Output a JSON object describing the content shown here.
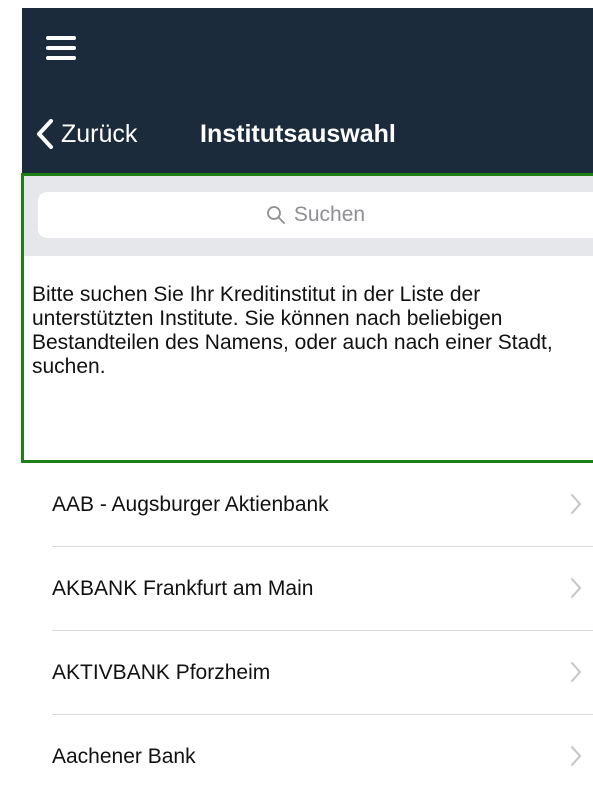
{
  "nav": {
    "back_label": "Zurück",
    "title": "Institutsauswahl"
  },
  "search": {
    "placeholder": "Suchen",
    "help_text": "Bitte suchen Sie Ihr Kreditinstitut in der Liste der unterstützten Institute. Sie können nach beliebigen Bestandteilen des Namens, oder auch nach einer Stadt, suchen."
  },
  "banks": [
    {
      "name": "AAB - Augsburger Aktienbank"
    },
    {
      "name": "AKBANK Frankfurt am Main"
    },
    {
      "name": "AKTIVBANK Pforzheim"
    },
    {
      "name": "Aachener Bank"
    }
  ],
  "colors": {
    "header_bg": "#1b2b3c",
    "highlight_border": "#1e7f16",
    "search_bar_bg": "#e6e7eb",
    "placeholder_text": "#8e8e93"
  }
}
